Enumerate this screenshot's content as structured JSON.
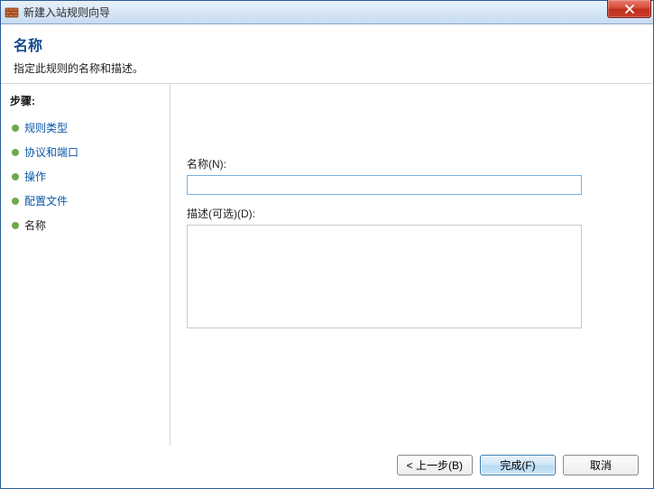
{
  "titlebar": {
    "title": "新建入站规则向导"
  },
  "header": {
    "title": "名称",
    "subtitle": "指定此规则的名称和描述。"
  },
  "sidebar": {
    "steps_label": "步骤:",
    "items": [
      {
        "label": "规则类型",
        "link": true
      },
      {
        "label": "协议和端口",
        "link": true
      },
      {
        "label": "操作",
        "link": true
      },
      {
        "label": "配置文件",
        "link": true
      },
      {
        "label": "名称",
        "link": false
      }
    ]
  },
  "form": {
    "name_label": "名称(N):",
    "name_value": "",
    "desc_label": "描述(可选)(D):",
    "desc_value": ""
  },
  "buttons": {
    "back": "< 上一步(B)",
    "finish": "完成(F)",
    "cancel": "取消"
  }
}
